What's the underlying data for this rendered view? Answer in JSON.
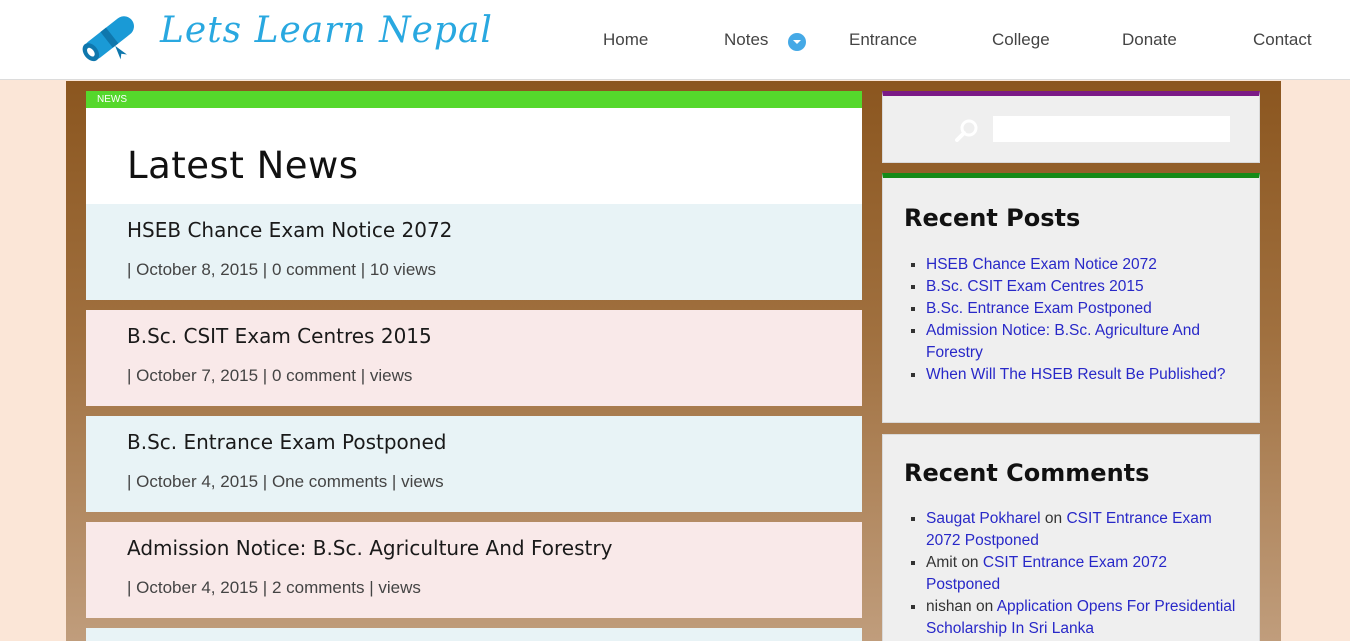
{
  "site": {
    "name": "Lets Learn Nepal"
  },
  "nav": {
    "home": "Home",
    "notes": "Notes",
    "entrance": "Entrance",
    "college": "College",
    "donate": "Donate",
    "contact": "Contact"
  },
  "main": {
    "tag": "NEWS",
    "title": "Latest News",
    "posts": [
      {
        "title": "HSEB Chance Exam Notice 2072",
        "date": "October 8, 2015",
        "comments": "0 comment",
        "views": "10 views"
      },
      {
        "title": "B.Sc. CSIT Exam Centres 2015",
        "date": "October 7, 2015",
        "comments": "0 comment",
        "views": "views"
      },
      {
        "title": "B.Sc. Entrance Exam Postponed",
        "date": "October 4, 2015",
        "comments": "One comments",
        "views": "views"
      },
      {
        "title": "Admission Notice: B.Sc. Agriculture And Forestry",
        "date": "October 4, 2015",
        "comments": "2 comments",
        "views": "views"
      }
    ]
  },
  "sidebar": {
    "search": {
      "placeholder": ""
    },
    "recent_posts": {
      "title": "Recent Posts",
      "items": [
        "HSEB Chance Exam Notice 2072",
        "B.Sc. CSIT Exam Centres 2015",
        "B.Sc. Entrance Exam Postponed",
        "Admission Notice: B.Sc. Agriculture And Forestry",
        "When Will The HSEB Result Be Published?"
      ]
    },
    "recent_comments": {
      "title": "Recent Comments",
      "items": [
        {
          "author": "Saugat Pokharel",
          "connector": "on",
          "post": "CSIT Entrance Exam 2072 Postponed"
        },
        {
          "author": "Amit",
          "connector": "on",
          "post": "CSIT Entrance Exam 2072 Postponed"
        },
        {
          "author": "nishan",
          "connector": "on",
          "post": "Application Opens For Presidential Scholarship In Sri Lanka"
        }
      ]
    }
  },
  "colors": {
    "brand": "#29a8e0",
    "news_tag": "#55d82c",
    "search_bar_accent": "#7b1a86",
    "recent_posts_accent": "#158a18",
    "link": "#2828c8"
  },
  "icons": [
    "diploma-scroll-icon",
    "dropdown-arrow-icon",
    "search-icon"
  ]
}
